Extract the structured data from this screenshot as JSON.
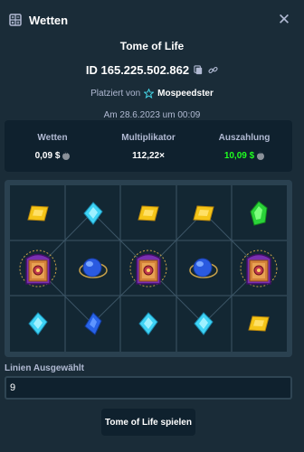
{
  "header": {
    "title": "Wetten",
    "icon": "bets-icon",
    "close_icon": "close-icon"
  },
  "bet": {
    "game": "Tome of Life",
    "id": "ID 165.225.502.862",
    "placed_prefix": "Platziert von",
    "user": "Mospeedster",
    "date": "Am 28.6.2023 um 00:09"
  },
  "stats": {
    "wager_label": "Wetten",
    "wager_value": "0,09 $",
    "multiplier_label": "Multiplikator",
    "multiplier_value": "112,22×",
    "payout_label": "Auszahlung",
    "payout_value": "10,09 $",
    "payout_color": "#1fff20"
  },
  "board": {
    "rows": [
      [
        "gold-gem",
        "cyan-gem",
        "gold-gem",
        "gold-gem",
        "green-gem"
      ],
      [
        "tome-book",
        "blue-orb",
        "tome-book",
        "blue-orb",
        "tome-book"
      ],
      [
        "cyan-gem",
        "blue-gem",
        "cyan-gem",
        "cyan-gem",
        "gold-gem"
      ]
    ]
  },
  "lines_field": {
    "label": "Linien Ausgewählt",
    "value": "9"
  },
  "play_button": {
    "label": "Tome of Life spielen"
  }
}
